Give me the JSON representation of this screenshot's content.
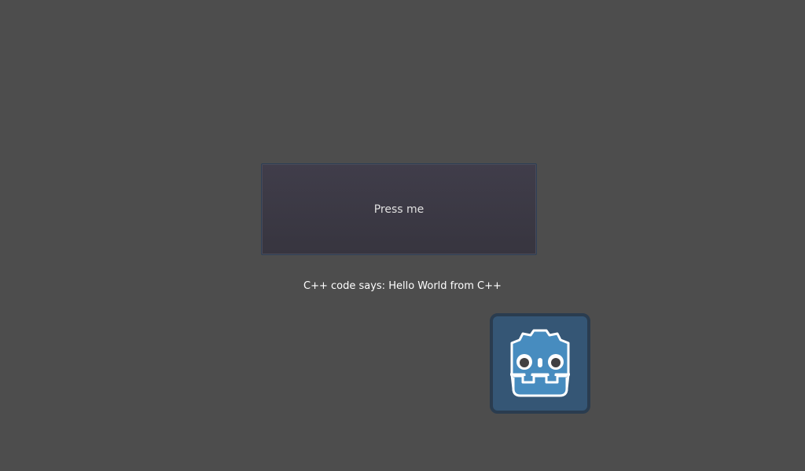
{
  "button": {
    "label": "Press me"
  },
  "message": {
    "text": "C++ code says: Hello World from C++"
  },
  "logo": {
    "icon": "godot-logo-icon",
    "colors": {
      "body": "#478cbf",
      "frame": "#355675",
      "eye": "#414042"
    }
  }
}
